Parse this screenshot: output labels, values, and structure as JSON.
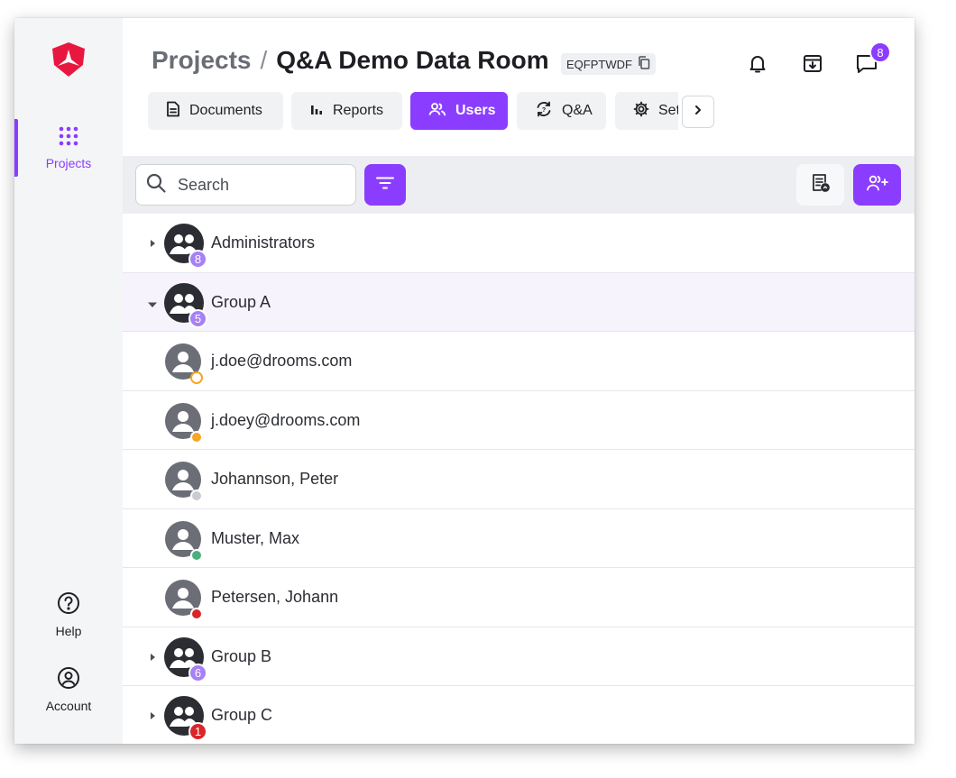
{
  "sidebar": {
    "logo_icon": "drooms-shield-logo",
    "items": [
      {
        "label": "Projects",
        "icon": "grid-dots-icon",
        "active": true
      },
      {
        "label": "Help",
        "icon": "help-circle-icon"
      },
      {
        "label": "Account",
        "icon": "account-circle-icon"
      }
    ]
  },
  "header": {
    "breadcrumb_root": "Projects",
    "breadcrumb_sep": "/",
    "project_name": "Q&A Demo Data Room",
    "project_code": "EQFPTWDF",
    "chat_count": "8"
  },
  "tabs": [
    {
      "label": "Documents",
      "icon": "document-icon"
    },
    {
      "label": "Reports",
      "icon": "bar-chart-icon"
    },
    {
      "label": "Users",
      "icon": "users-icon",
      "active": true
    },
    {
      "label": "Q&A",
      "icon": "qa-cycle-icon"
    },
    {
      "label": "Settings",
      "icon": "gear-icon"
    }
  ],
  "toolbar": {
    "search_placeholder": "Search"
  },
  "rows": [
    {
      "type": "group",
      "name": "Administrators",
      "count": "8",
      "expanded": false
    },
    {
      "type": "group",
      "name": "Group A",
      "count": "5",
      "expanded": true
    },
    {
      "type": "user",
      "name": "j.doe@drooms.com",
      "status": "pending"
    },
    {
      "type": "user",
      "name": "j.doey@drooms.com",
      "status": "invited"
    },
    {
      "type": "user",
      "name": "Johannson, Peter",
      "status": "inactive"
    },
    {
      "type": "user",
      "name": "Muster, Max",
      "status": "active"
    },
    {
      "type": "user",
      "name": "Petersen, Johann",
      "status": "blocked"
    },
    {
      "type": "group",
      "name": "Group B",
      "count": "6",
      "expanded": false
    },
    {
      "type": "group",
      "name": "Group C",
      "count": "1",
      "expanded": false,
      "alert": true
    }
  ],
  "colors": {
    "accent": "#8b3dff",
    "status_pending": "#f5a623",
    "status_invited": "#f5a623",
    "status_inactive": "#c9ccd2",
    "status_active": "#4caf7d",
    "status_blocked": "#d9262b"
  }
}
